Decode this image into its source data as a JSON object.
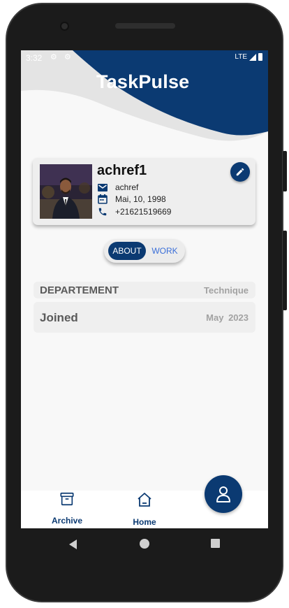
{
  "status_bar": {
    "time": "3:32",
    "network": "LTE"
  },
  "app": {
    "title": "TaskPulse"
  },
  "colors": {
    "primary": "#0b3a72",
    "accent_text": "#3b6fd8",
    "card_bg": "#eeeeee"
  },
  "profile": {
    "username": "achref1",
    "email": "achref",
    "birthdate": "Mai, 10, 1998",
    "phone": "+21621519669",
    "icons": {
      "email": "mail-icon",
      "birthdate": "calendar-icon",
      "phone": "phone-icon",
      "edit": "pencil-icon"
    }
  },
  "tabs": {
    "about": "ABOUT",
    "work": "WORK",
    "selected": "ABOUT"
  },
  "details": {
    "department_label": "DEPARTEMENT",
    "department_value": "Technique",
    "joined_label": "Joined",
    "joined_value": "May 2023"
  },
  "bottom_nav": {
    "archive_label": "Archive",
    "home_label": "Home",
    "profile_icon": "person-icon"
  }
}
